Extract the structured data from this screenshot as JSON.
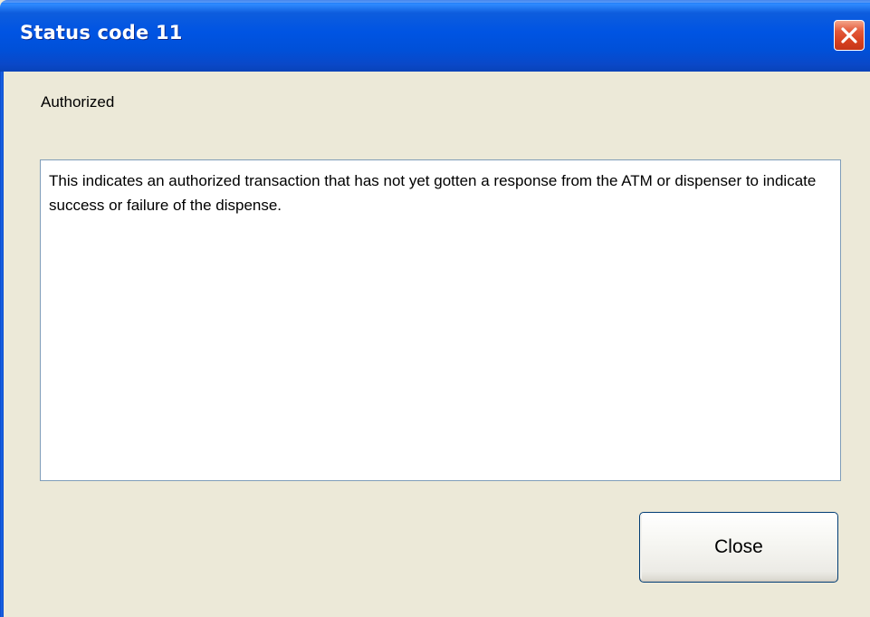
{
  "window": {
    "title": "Status code 11"
  },
  "titlebar_buttons": {
    "close_icon": "close-x-icon"
  },
  "content": {
    "status_label": "Authorized",
    "description": "This indicates an authorized transaction that has not yet gotten a response from the ATM or dispenser to indicate success or failure of the dispense."
  },
  "buttons": {
    "close_label": "Close"
  },
  "colors": {
    "titlebar": "#0054E3",
    "close_x_button": "#D7401F",
    "window_background": "#ECE9D8",
    "textbox_border": "#7F9DB9",
    "button_border": "#003C74"
  }
}
